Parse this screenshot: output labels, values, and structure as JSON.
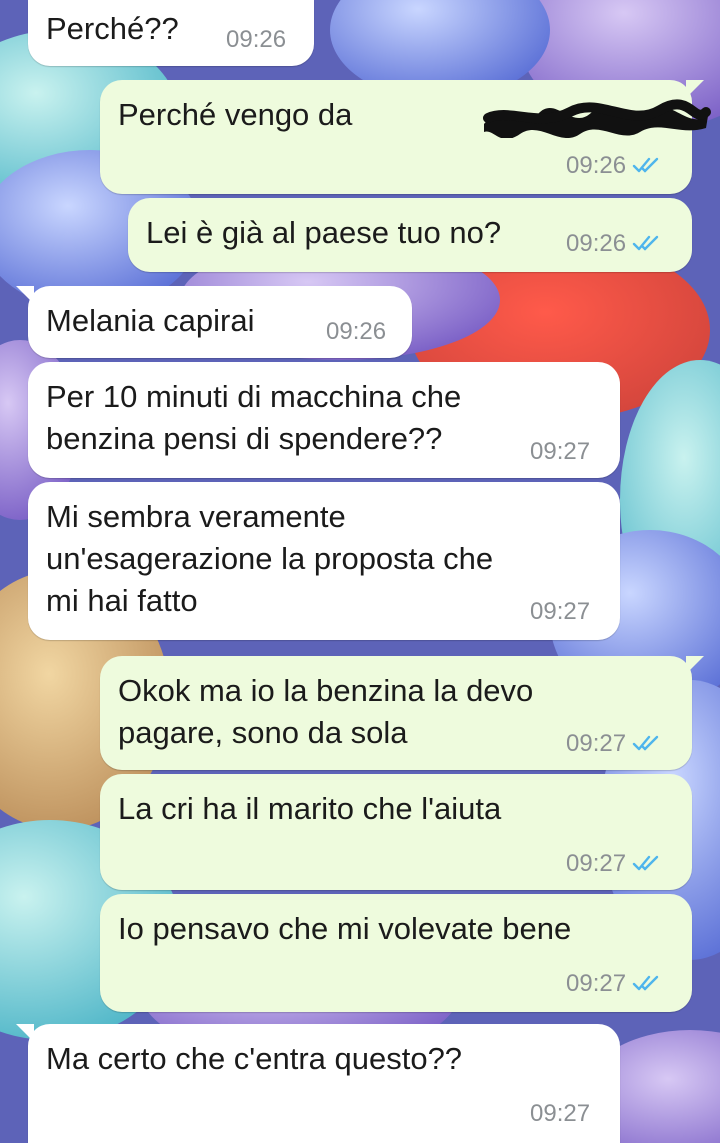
{
  "colors": {
    "incoming_bubble": "#ffffff",
    "outgoing_bubble": "#eefbdd",
    "read_ticks": "#4fb5ec",
    "timestamp": "#8b8f93"
  },
  "messages": [
    {
      "direction": "incoming",
      "text": "Perché??",
      "time": "09:26"
    },
    {
      "direction": "outgoing",
      "text": "Perché vengo da",
      "redacted": true,
      "time": "09:26",
      "status": "read"
    },
    {
      "direction": "outgoing",
      "text": "Lei è già al paese tuo no?",
      "time": "09:26",
      "status": "read"
    },
    {
      "direction": "incoming",
      "text": "Melania capirai",
      "time": "09:26"
    },
    {
      "direction": "incoming",
      "text": "Per 10 minuti di macchina che\nbenzina pensi di spendere??",
      "time": "09:27"
    },
    {
      "direction": "incoming",
      "text": "Mi sembra veramente\nun'esagerazione la proposta che\nmi hai fatto",
      "time": "09:27"
    },
    {
      "direction": "outgoing",
      "text": "Okok ma io la benzina la devo\npagare, sono da sola",
      "time": "09:27",
      "status": "read"
    },
    {
      "direction": "outgoing",
      "text": "La cri ha il marito che l'aiuta",
      "time": "09:27",
      "status": "read"
    },
    {
      "direction": "outgoing",
      "text": "Io pensavo che mi volevate bene",
      "time": "09:27",
      "status": "read"
    },
    {
      "direction": "incoming",
      "text": "Ma certo che c'entra questo??",
      "time": "09:27"
    }
  ]
}
